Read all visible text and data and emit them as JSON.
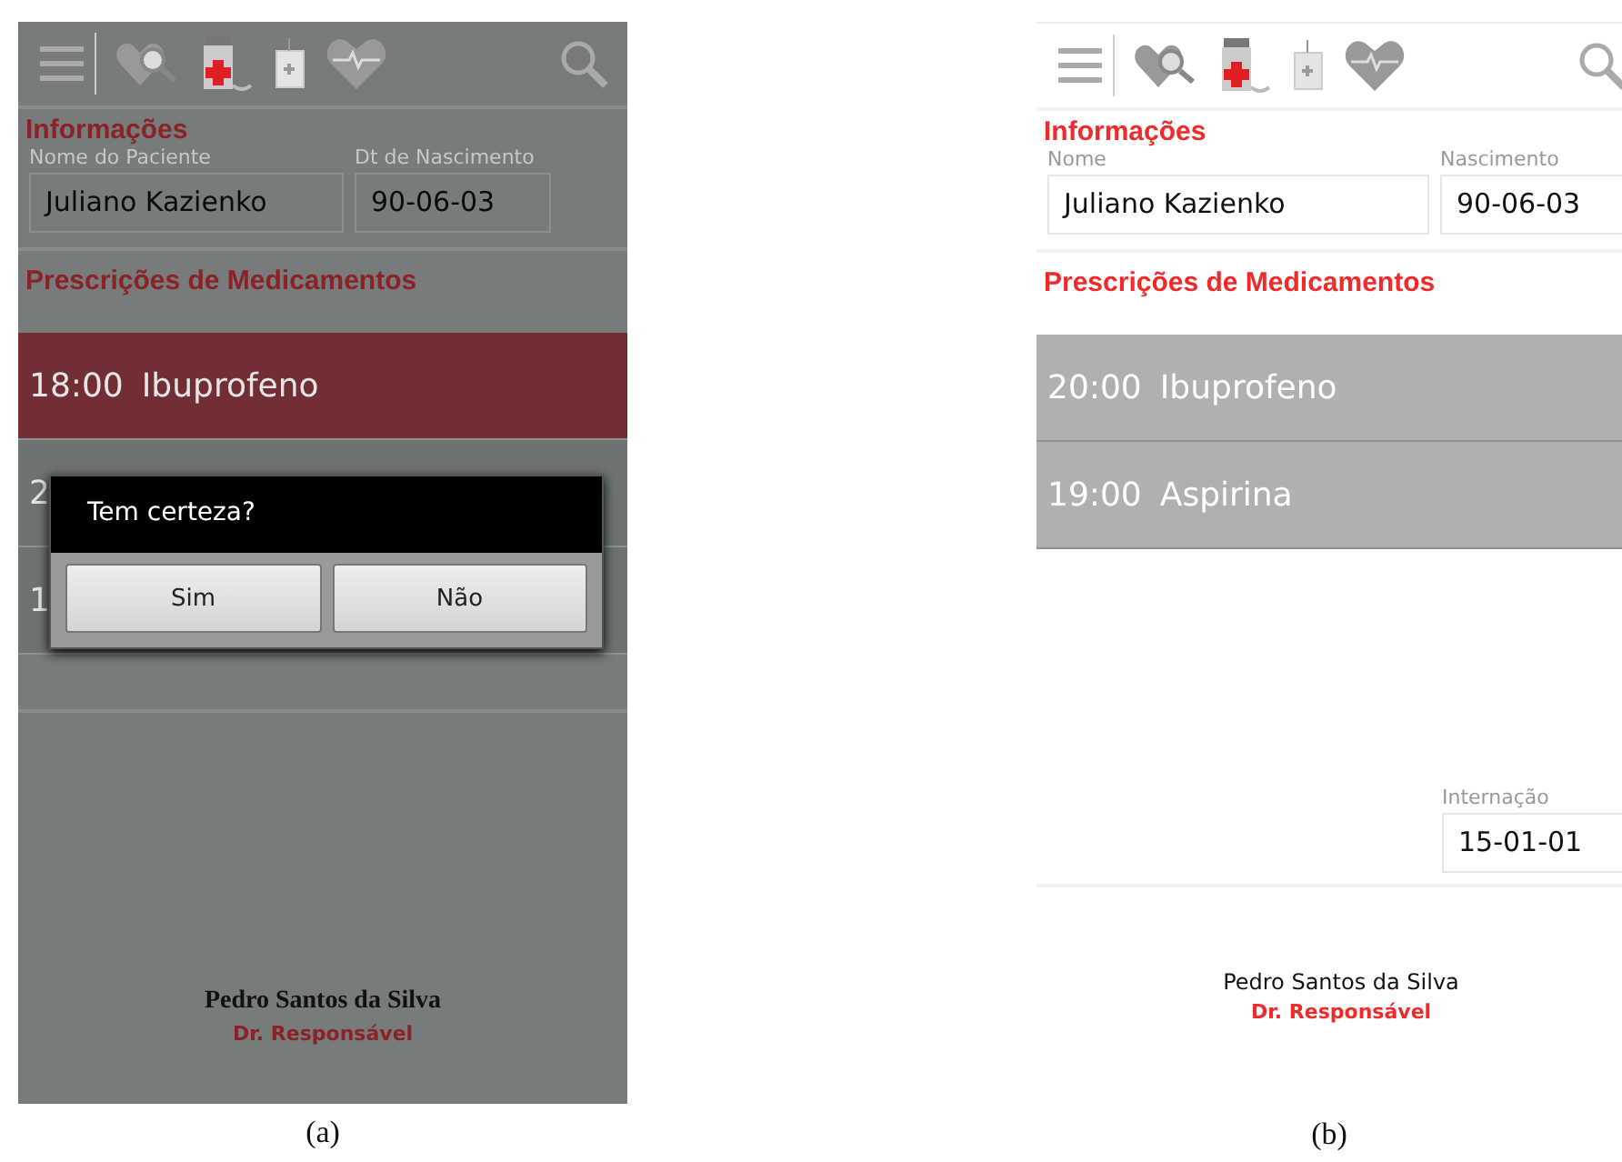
{
  "screens": [
    {
      "caption": "(a)",
      "section_title": "Informações",
      "fields": [
        {
          "label": "Nome do Paciente",
          "value": "Juliano Kazienko"
        },
        {
          "label": "Dt de Nascimento",
          "value": "90-06-03"
        }
      ],
      "list_title": "Prescrições de Medicamentos",
      "prescriptions": [
        {
          "time": "18:00",
          "drug": "Ibuprofeno",
          "selected": true
        },
        {
          "time": "2",
          "selected": false
        },
        {
          "time": "1",
          "selected": false
        }
      ],
      "dialog": {
        "title": "Tem certeza?",
        "buttons": [
          "Sim",
          "Não"
        ]
      },
      "doctor": {
        "name": "Pedro Santos da Silva",
        "role": "Dr. Responsável"
      }
    },
    {
      "caption": "(b)",
      "section_title": "Informações",
      "fields": [
        {
          "label": "Nome",
          "value": "Juliano Kazienko"
        },
        {
          "label": "Nascimento",
          "value": "90-06-03"
        }
      ],
      "list_title": "Prescrições de Medicamentos",
      "prescriptions": [
        {
          "time": "20:00",
          "drug": "Ibuprofeno",
          "selected": false
        },
        {
          "time": "19:00",
          "drug": "Aspirina",
          "selected": false
        }
      ],
      "admission": {
        "label": "Internação",
        "value": "15-01-01"
      },
      "doctor": {
        "name": "Pedro Santos da Silva",
        "role": "Dr. Responsável"
      }
    }
  ]
}
